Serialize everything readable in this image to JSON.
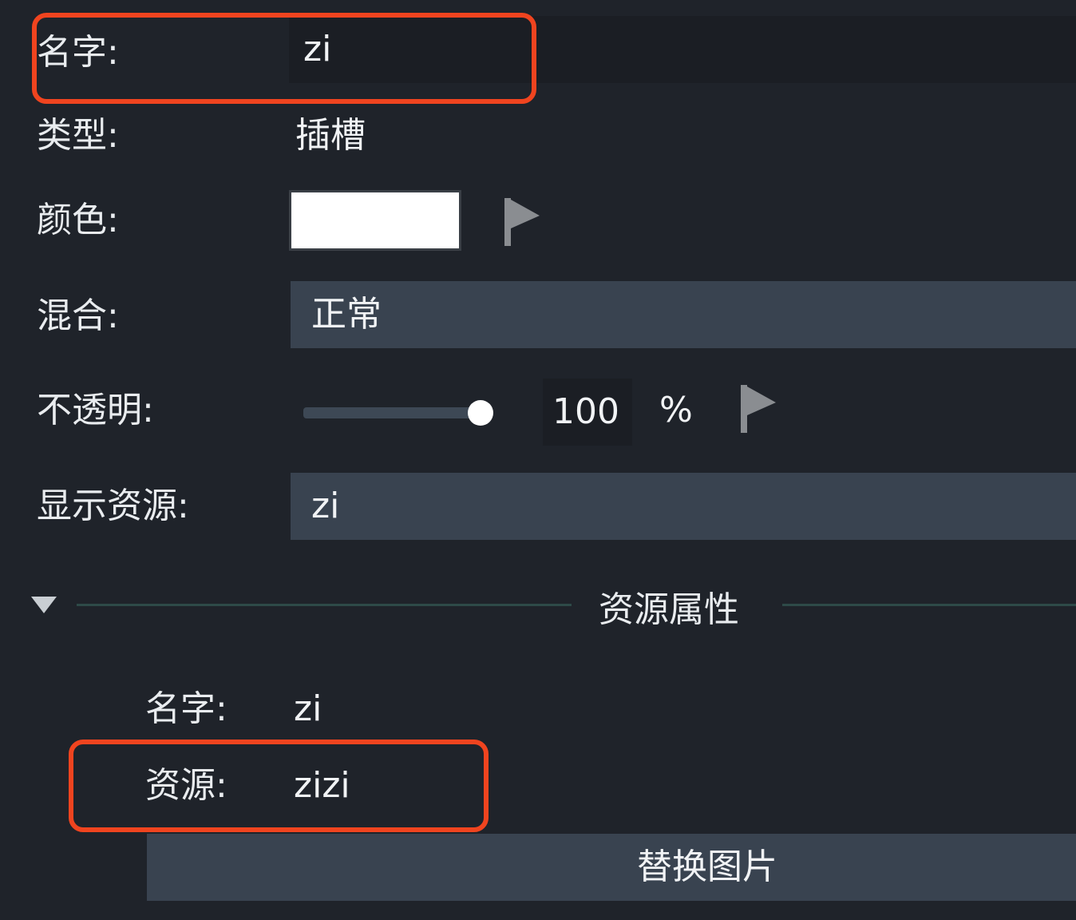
{
  "properties": {
    "name": {
      "label": "名字:",
      "value": "zi"
    },
    "type": {
      "label": "类型:",
      "value": "插槽"
    },
    "color": {
      "label": "颜色:",
      "swatch": "#ffffff",
      "flag_icon": "flag-icon"
    },
    "blend": {
      "label": "混合:",
      "value": "正常"
    },
    "opacity": {
      "label": "不透明:",
      "value": "100",
      "unit": "%",
      "slider_fraction": 1.0,
      "flag_icon": "flag-icon"
    },
    "display_resource": {
      "label": "显示资源:",
      "value": "zi"
    }
  },
  "resource_section": {
    "title": "资源属性",
    "collapse_icon": "triangle-down-icon",
    "name": {
      "label": "名字:",
      "value": "zi"
    },
    "resource": {
      "label": "资源:",
      "value": "zizi"
    },
    "replace_button": "替换图片"
  },
  "colors": {
    "background": "#1f232a",
    "field": "#394350",
    "highlight": "#f0441f",
    "divider": "#2e4a48"
  }
}
